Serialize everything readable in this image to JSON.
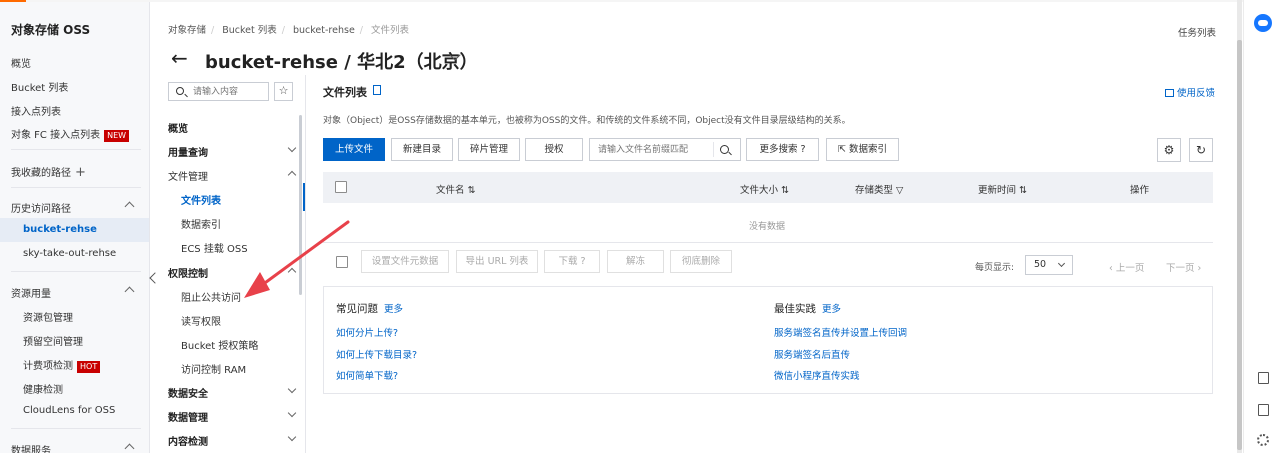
{
  "sidebar": {
    "title": "对象存储 OSS",
    "items": [
      {
        "label": "概览"
      },
      {
        "label": "Bucket 列表"
      },
      {
        "label": "接入点列表"
      },
      {
        "label": "对象 FC 接入点列表",
        "badge": "NEW"
      },
      {
        "label": "我收藏的路径"
      },
      {
        "label": "历史访问路径"
      },
      {
        "label": "bucket-rehse"
      },
      {
        "label": "sky-take-out-rehse"
      },
      {
        "label": "资源用量"
      },
      {
        "label": "资源包管理"
      },
      {
        "label": "预留空间管理"
      },
      {
        "label": "计费项检测",
        "badge": "HOT"
      },
      {
        "label": "健康检测"
      },
      {
        "label": "CloudLens for OSS"
      },
      {
        "label": "数据服务"
      }
    ]
  },
  "breadcrumb": [
    "对象存储",
    "Bucket 列表",
    "bucket-rehse",
    "文件列表"
  ],
  "header": {
    "title": "bucket-rehse / 华北2（北京）",
    "task_list": "任务列表"
  },
  "midnav": {
    "search_placeholder": "请输入内容",
    "items": [
      {
        "label": "概览"
      },
      {
        "label": "用量查询"
      },
      {
        "label": "文件管理"
      },
      {
        "label": "文件列表"
      },
      {
        "label": "数据索引"
      },
      {
        "label": "ECS 挂载 OSS"
      },
      {
        "label": "权限控制"
      },
      {
        "label": "阻止公共访问"
      },
      {
        "label": "读写权限"
      },
      {
        "label": "Bucket 授权策略"
      },
      {
        "label": "访问控制 RAM"
      },
      {
        "label": "数据安全"
      },
      {
        "label": "数据管理"
      },
      {
        "label": "内容检测"
      }
    ]
  },
  "main": {
    "title": "文件列表",
    "feedback": "使用反馈",
    "description": "对象（Object）是OSS存储数据的基本单元，也被称为OSS的文件。和传统的文件系统不同，Object没有文件目录层级结构的关系。",
    "toolbar": {
      "upload": "上传文件",
      "new_dir": "新建目录",
      "fragments": "碎片管理",
      "authorize": "授权",
      "search_placeholder": "请输入文件名前缀匹配",
      "more_search": "更多搜索",
      "data_index": "数据索引"
    },
    "table": {
      "columns": [
        "文件名",
        "文件大小",
        "存储类型",
        "更新时间",
        "操作"
      ],
      "empty": "没有数据"
    },
    "bulk": {
      "set_meta": "设置文件元数据",
      "export_url": "导出 URL 列表",
      "download": "下载",
      "unfreeze": "解冻",
      "delete": "彻底删除"
    },
    "pager": {
      "label": "每页显示:",
      "size": "50",
      "prev": "上一页",
      "next": "下一页"
    },
    "faq": {
      "title": "常见问题",
      "more": "更多",
      "links": [
        "如何分片上传?",
        "如何上传下载目录?",
        "如何简单下载?"
      ]
    },
    "best": {
      "title": "最佳实践",
      "more": "更多",
      "links": [
        "服务端签名直传并设置上传回调",
        "服务端签名后直传",
        "微信小程序直传实践"
      ]
    }
  },
  "colors": {
    "accent": "#0064c8",
    "badge": "#c80000",
    "annotation": "#e8414a"
  }
}
